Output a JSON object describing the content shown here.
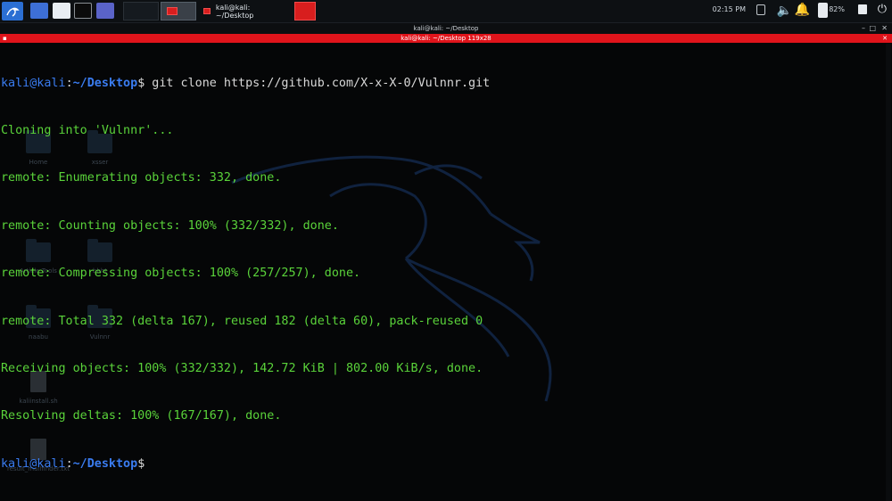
{
  "panel": {
    "clock": "02:15 PM",
    "battery": "82%",
    "task_title": "kali@kali: ~/Desktop"
  },
  "window": {
    "title": "kali@kali: ~/Desktop",
    "subtitle": "kali@kali: ~/Desktop 119x28"
  },
  "desktop": {
    "icons": [
      "Home",
      "xsser",
      "Article Tools",
      "bbht",
      "naabu",
      "Vulnnr",
      "kaliinstall.sh",
      "result_mailfinder.txt"
    ]
  },
  "terminal": {
    "prompt_user": "kali@kali",
    "prompt_sep": ":",
    "prompt_path": "~/Desktop",
    "prompt_end": "$",
    "command": " git clone https://github.com/X-x-X-0/Vulnnr.git",
    "output": [
      "Cloning into 'Vulnnr'...",
      "remote: Enumerating objects: 332, done.",
      "remote: Counting objects: 100% (332/332), done.",
      "remote: Compressing objects: 100% (257/257), done.",
      "remote: Total 332 (delta 167), reused 182 (delta 60), pack-reused 0",
      "Receiving objects: 100% (332/332), 142.72 KiB | 802.00 KiB/s, done.",
      "Resolving deltas: 100% (167/167), done."
    ]
  },
  "colors": {
    "accent_red": "#e0141b",
    "prompt_blue": "#3a7cf0",
    "output_green": "#5ad33a"
  }
}
